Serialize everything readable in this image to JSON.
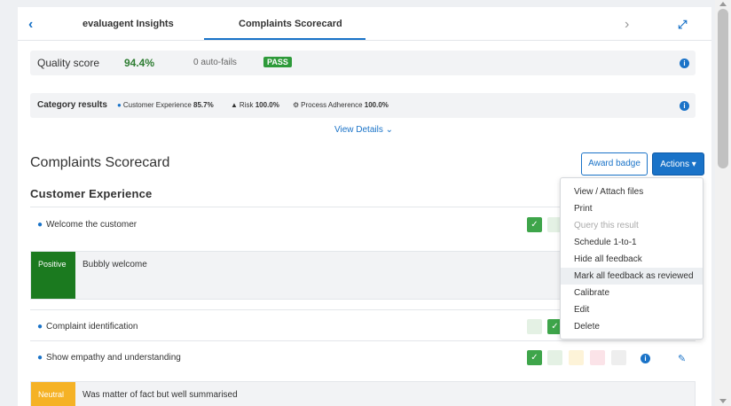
{
  "tabs": {
    "back_icon": "chevron-left-icon",
    "items": [
      {
        "label": "evaluagent Insights"
      },
      {
        "label": "Complaints Scorecard"
      }
    ],
    "next_icon": "chevron-right-icon",
    "expand_icon": "expand-icon",
    "active_color": "#1a73c8"
  },
  "quality": {
    "label": "Quality score",
    "value": "94.4%",
    "auto_fails": "0 auto-fails",
    "status": "PASS"
  },
  "categories": {
    "label": "Category results",
    "items": [
      {
        "icon": "user-icon",
        "name": "Customer Experience",
        "value": "85.7%"
      },
      {
        "icon": "warning-icon",
        "name": "Risk",
        "value": "100.0%"
      },
      {
        "icon": "gear-icon",
        "name": "Process Adherence",
        "value": "100.0%"
      }
    ]
  },
  "view_details": "View Details",
  "scorecard": {
    "title": "Complaints Scorecard",
    "award_label": "Award badge",
    "actions_label": "Actions"
  },
  "section": {
    "title": "Customer Experience",
    "questions": [
      {
        "label": "Welcome the customer"
      },
      {
        "label": "Complaint identification"
      },
      {
        "label": "Show empathy and understanding"
      }
    ],
    "feedback": [
      {
        "tag": "Positive",
        "text": "Bubbly welcome"
      },
      {
        "tag": "Neutral",
        "text": "Was matter of fact but well summarised"
      }
    ]
  },
  "actions_menu": [
    {
      "label": "View / Attach files"
    },
    {
      "label": "Print"
    },
    {
      "label": "Query this result"
    },
    {
      "label": "Schedule 1-to-1"
    },
    {
      "label": "Hide all feedback"
    },
    {
      "label": "Mark all feedback as reviewed"
    },
    {
      "label": "Calibrate"
    },
    {
      "label": "Edit"
    },
    {
      "label": "Delete"
    }
  ],
  "colors": {
    "accent": "#1a73c8",
    "pass": "#2e9a3a",
    "positive": "#1b7a1f",
    "neutral": "#f5b226"
  }
}
